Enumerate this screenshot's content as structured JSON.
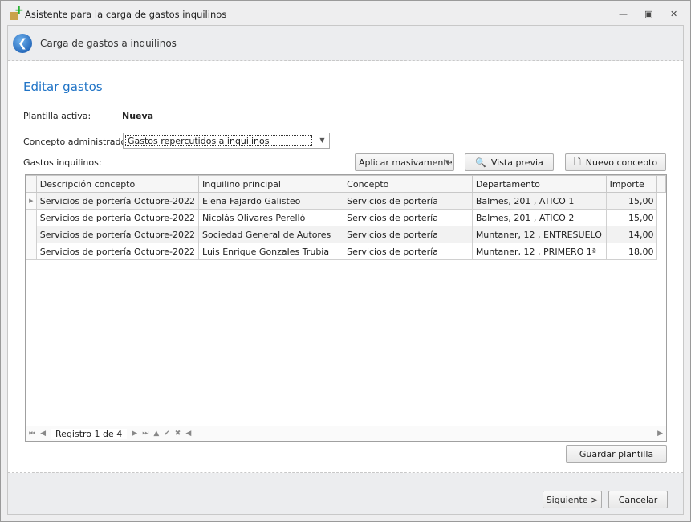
{
  "window": {
    "title": "Asistente para la carga de gastos inquilinos"
  },
  "header": {
    "title": "Carga de gastos a inquilinos"
  },
  "section_title": "Editar gastos",
  "plantilla": {
    "label": "Plantilla activa:",
    "value": "Nueva"
  },
  "concepto_admin": {
    "label": "Concepto administrador:",
    "value": "Gastos repercutidos a inquilinos"
  },
  "gastos_label": "Gastos inquilinos:",
  "toolbar": {
    "aplicar": "Aplicar masivamente",
    "vista": "Vista previa",
    "nuevo": "Nuevo concepto"
  },
  "table": {
    "columns": [
      "Descripción concepto",
      "Inquilino principal",
      "Concepto",
      "Departamento",
      "Importe"
    ],
    "rows": [
      [
        "Servicios de portería Octubre-2022",
        "Elena Fajardo Galisteo",
        "Servicios de portería",
        "Balmes, 201 , ATICO 1",
        "15,00"
      ],
      [
        "Servicios de portería Octubre-2022",
        "Nicolás Olivares Perelló",
        "Servicios de portería",
        "Balmes, 201 , ATICO 2",
        "15,00"
      ],
      [
        "Servicios de portería Octubre-2022",
        "Sociedad General de Autores",
        "Servicios de portería",
        "Muntaner, 12 , ENTRESUELO",
        "14,00"
      ],
      [
        "Servicios de portería Octubre-2022",
        "Luis Enrique Gonzales Trubia",
        "Servicios de portería",
        "Muntaner, 12 , PRIMERO 1ª",
        "18,00"
      ]
    ]
  },
  "navigator": {
    "record": "Registro 1 de 4"
  },
  "buttons": {
    "guardar": "Guardar plantilla",
    "siguiente": "Siguiente >",
    "cancelar": "Cancelar"
  }
}
